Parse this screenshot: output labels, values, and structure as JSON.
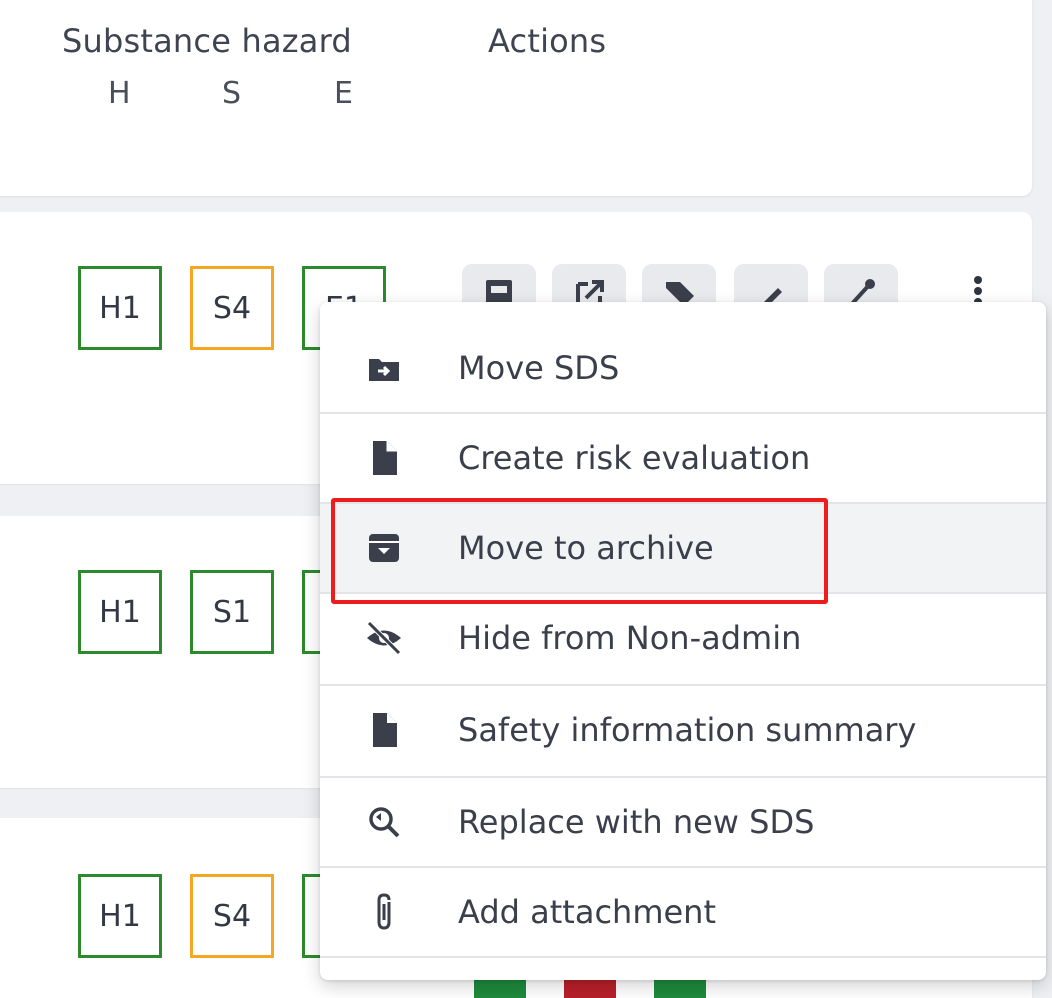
{
  "table_header": {
    "substance_hazard": "Substance hazard",
    "actions": "Actions",
    "hse_letters": [
      "H",
      "S",
      "E"
    ]
  },
  "rows": [
    {
      "h": "H1",
      "s": "S4",
      "e": "E1",
      "h_color": "#2b8a2b",
      "s_color": "#f5a623",
      "e_color": "#2b8a2b"
    },
    {
      "h": "H1",
      "s": "S1",
      "e": "",
      "h_color": "#2b8a2b",
      "s_color": "#2b8a2b",
      "e_color": "#2b8a2b"
    },
    {
      "h": "H1",
      "s": "S4",
      "e": "",
      "h_color": "#2b8a2b",
      "s_color": "#f5a623",
      "e_color": "#2b8a2b"
    }
  ],
  "row_actions": [
    {
      "icon": "pdf-icon"
    },
    {
      "icon": "open-external-icon"
    },
    {
      "icon": "tag-icon"
    },
    {
      "icon": "pencil-icon"
    },
    {
      "icon": "share-icon"
    }
  ],
  "menu": {
    "items": [
      {
        "label": "Move SDS",
        "icon": "folder-move-icon"
      },
      {
        "label": "Create risk evaluation",
        "icon": "document-icon"
      },
      {
        "label": "Move to archive",
        "icon": "archive-icon",
        "highlighted": true
      },
      {
        "label": "Hide from Non-admin",
        "icon": "eye-slash-icon"
      },
      {
        "label": "Safety information summary",
        "icon": "file-lines-icon"
      },
      {
        "label": "Replace with new SDS",
        "icon": "search-replace-icon"
      },
      {
        "label": "Add attachment",
        "icon": "paperclip-icon"
      }
    ]
  },
  "colors": {
    "green_badge": "#2b8a2b",
    "orange_badge": "#f5a623",
    "highlight_border": "#ee1c1c"
  }
}
